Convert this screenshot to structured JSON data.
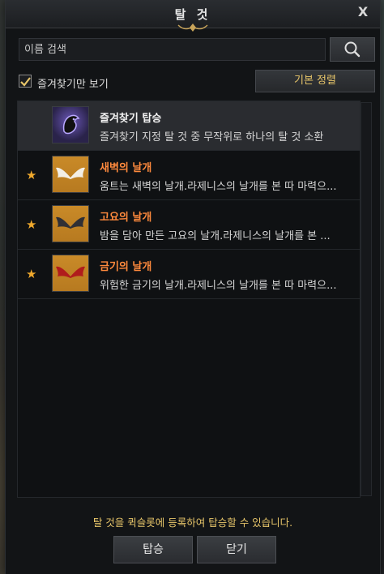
{
  "window": {
    "title": "탈 것"
  },
  "search": {
    "placeholder": "이름 검색"
  },
  "filter": {
    "favorites_only_label": "즐겨찾기만 보기",
    "favorites_only_checked": true
  },
  "sort": {
    "label": "기본 정렬"
  },
  "mounts": [
    {
      "name": "즐겨찾기 탑승",
      "desc": "즐겨찾기 지정 탈 것 중 무작위로 하나의 탈 것 소환",
      "favorite": false,
      "name_color": "#f2f2f2",
      "icon": "mount-horse-emblem-icon"
    },
    {
      "name": "새벽의 날개",
      "desc": "움트는 새벽의 날개.라제니스의 날개를 본 따 마력으...",
      "favorite": true,
      "name_color": "#ff8a3d",
      "icon": "white-wings-icon"
    },
    {
      "name": "고요의 날개",
      "desc": "밤을 담아 만든 고요의 날개.라제니스의 날개를 본 ...",
      "favorite": true,
      "name_color": "#ff8a3d",
      "icon": "dark-wings-icon"
    },
    {
      "name": "금기의 날개",
      "desc": "위험한 금기의 날개.라제니스의 날개를 본 따 마력으...",
      "favorite": true,
      "name_color": "#ff8a3d",
      "icon": "red-wings-icon"
    }
  ],
  "footer": {
    "message": "탈 것을 퀵슬롯에 등록하여 탑승할 수 있습니다.",
    "ride_label": "탑승",
    "close_label": "닫기"
  },
  "colors": {
    "accent": "#e8c66a",
    "epic": "#ff8a3d",
    "star": "#f0a92d"
  }
}
